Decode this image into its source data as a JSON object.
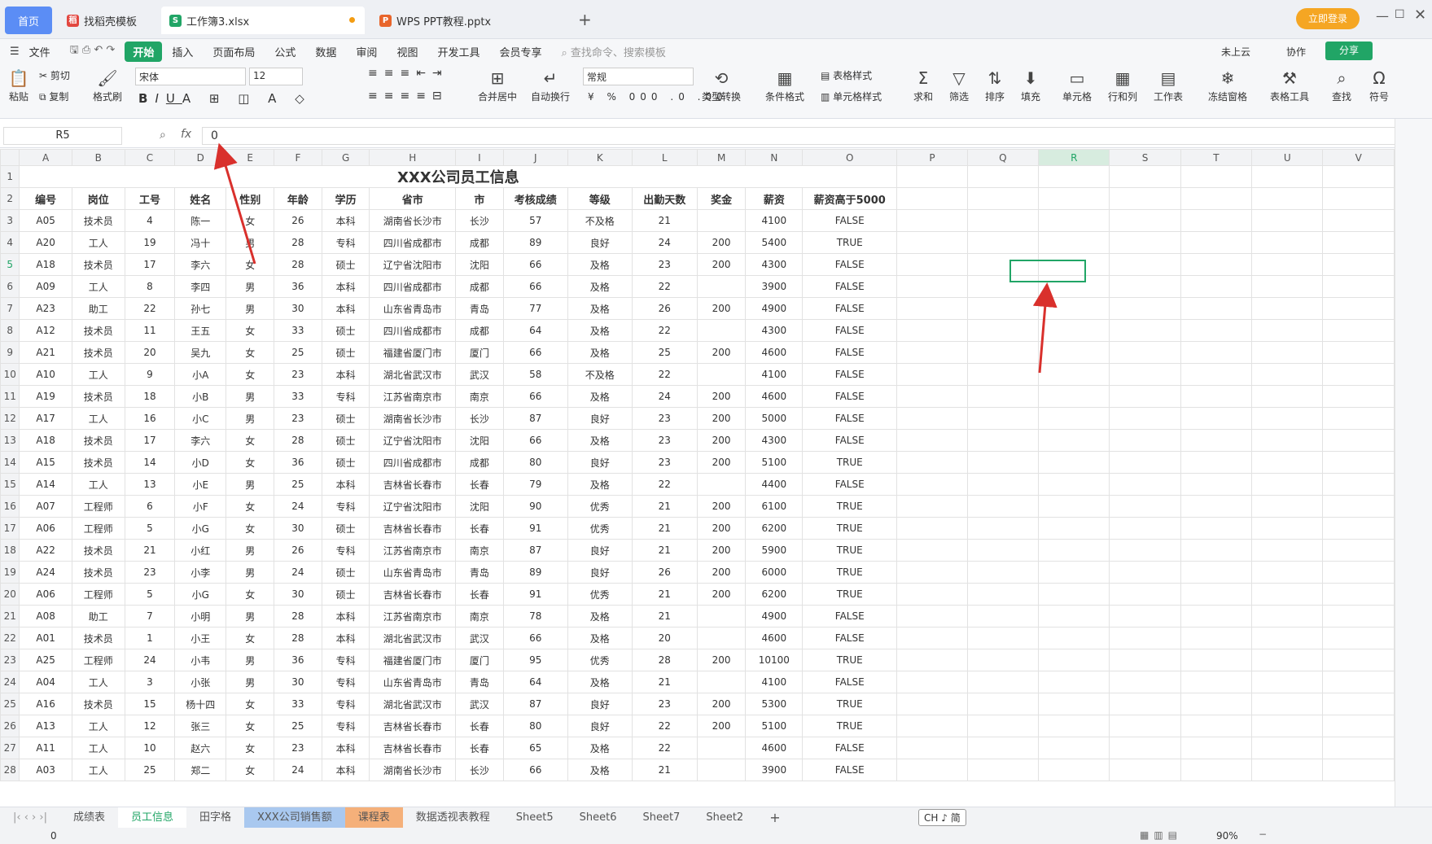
{
  "tabs": {
    "home": "首页",
    "t1": "找稻壳模板",
    "t2": "工作簿3.xlsx",
    "t3": "WPS PPT教程.pptx"
  },
  "titlebar": {
    "login": "立即登录"
  },
  "menu": [
    "文件",
    "开始",
    "插入",
    "页面布局",
    "公式",
    "数据",
    "审阅",
    "视图",
    "开发工具",
    "会员专享"
  ],
  "search": "查找命令、搜索模板",
  "right_menu": {
    "cloud": "未上云",
    "collab": "协作",
    "share": "分享"
  },
  "ribbon": {
    "paste": "粘贴",
    "cut": "剪切",
    "copy": "复制",
    "format_painter": "格式刷",
    "font": "宋体",
    "size": "12",
    "merge": "合并居中",
    "wrap": "自动换行",
    "numfmt": "常规",
    "convert": "类型转换",
    "cond": "条件格式",
    "table_style": "表格样式",
    "cell_style": "单元格样式",
    "sum": "求和",
    "filter": "筛选",
    "sort": "排序",
    "fill": "填充",
    "cell": "单元格",
    "rowcol": "行和列",
    "sheet": "工作表",
    "freeze": "冻结窗格",
    "tools": "表格工具",
    "find": "查找",
    "symbol": "符号"
  },
  "formula": {
    "cellref": "R5",
    "fx": "fx",
    "value": "0"
  },
  "sheet_title": "XXX公司员工信息",
  "columns": [
    "A",
    "B",
    "C",
    "D",
    "E",
    "F",
    "G",
    "H",
    "I",
    "J",
    "K",
    "L",
    "M",
    "N",
    "O",
    "P",
    "Q",
    "R",
    "S",
    "T",
    "U",
    "V"
  ],
  "headers": [
    "编号",
    "岗位",
    "工号",
    "姓名",
    "性别",
    "年龄",
    "学历",
    "省市",
    "市",
    "考核成绩",
    "等级",
    "出勤天数",
    "奖金",
    "薪资",
    "薪资高于5000"
  ],
  "rows": [
    [
      "A05",
      "技术员",
      "4",
      "陈一",
      "女",
      "26",
      "本科",
      "湖南省长沙市",
      "长沙",
      "57",
      "不及格",
      "21",
      "",
      "4100",
      "FALSE"
    ],
    [
      "A20",
      "工人",
      "19",
      "冯十",
      "男",
      "28",
      "专科",
      "四川省成都市",
      "成都",
      "89",
      "良好",
      "24",
      "200",
      "5400",
      "TRUE"
    ],
    [
      "A18",
      "技术员",
      "17",
      "李六",
      "女",
      "28",
      "硕士",
      "辽宁省沈阳市",
      "沈阳",
      "66",
      "及格",
      "23",
      "200",
      "4300",
      "FALSE"
    ],
    [
      "A09",
      "工人",
      "8",
      "李四",
      "男",
      "36",
      "本科",
      "四川省成都市",
      "成都",
      "66",
      "及格",
      "22",
      "",
      "3900",
      "FALSE"
    ],
    [
      "A23",
      "助工",
      "22",
      "孙七",
      "男",
      "30",
      "本科",
      "山东省青岛市",
      "青岛",
      "77",
      "及格",
      "26",
      "200",
      "4900",
      "FALSE"
    ],
    [
      "A12",
      "技术员",
      "11",
      "王五",
      "女",
      "33",
      "硕士",
      "四川省成都市",
      "成都",
      "64",
      "及格",
      "22",
      "",
      "4300",
      "FALSE"
    ],
    [
      "A21",
      "技术员",
      "20",
      "吴九",
      "女",
      "25",
      "硕士",
      "福建省厦门市",
      "厦门",
      "66",
      "及格",
      "25",
      "200",
      "4600",
      "FALSE"
    ],
    [
      "A10",
      "工人",
      "9",
      "小A",
      "女",
      "23",
      "本科",
      "湖北省武汉市",
      "武汉",
      "58",
      "不及格",
      "22",
      "",
      "4100",
      "FALSE"
    ],
    [
      "A19",
      "技术员",
      "18",
      "小B",
      "男",
      "33",
      "专科",
      "江苏省南京市",
      "南京",
      "66",
      "及格",
      "24",
      "200",
      "4600",
      "FALSE"
    ],
    [
      "A17",
      "工人",
      "16",
      "小C",
      "男",
      "23",
      "硕士",
      "湖南省长沙市",
      "长沙",
      "87",
      "良好",
      "23",
      "200",
      "5000",
      "FALSE"
    ],
    [
      "A18",
      "技术员",
      "17",
      "李六",
      "女",
      "28",
      "硕士",
      "辽宁省沈阳市",
      "沈阳",
      "66",
      "及格",
      "23",
      "200",
      "4300",
      "FALSE"
    ],
    [
      "A15",
      "技术员",
      "14",
      "小D",
      "女",
      "36",
      "硕士",
      "四川省成都市",
      "成都",
      "80",
      "良好",
      "23",
      "200",
      "5100",
      "TRUE"
    ],
    [
      "A14",
      "工人",
      "13",
      "小E",
      "男",
      "25",
      "本科",
      "吉林省长春市",
      "长春",
      "79",
      "及格",
      "22",
      "",
      "4400",
      "FALSE"
    ],
    [
      "A07",
      "工程师",
      "6",
      "小F",
      "女",
      "24",
      "专科",
      "辽宁省沈阳市",
      "沈阳",
      "90",
      "优秀",
      "21",
      "200",
      "6100",
      "TRUE"
    ],
    [
      "A06",
      "工程师",
      "5",
      "小G",
      "女",
      "30",
      "硕士",
      "吉林省长春市",
      "长春",
      "91",
      "优秀",
      "21",
      "200",
      "6200",
      "TRUE"
    ],
    [
      "A22",
      "技术员",
      "21",
      "小红",
      "男",
      "26",
      "专科",
      "江苏省南京市",
      "南京",
      "87",
      "良好",
      "21",
      "200",
      "5900",
      "TRUE"
    ],
    [
      "A24",
      "技术员",
      "23",
      "小李",
      "男",
      "24",
      "硕士",
      "山东省青岛市",
      "青岛",
      "89",
      "良好",
      "26",
      "200",
      "6000",
      "TRUE"
    ],
    [
      "A06",
      "工程师",
      "5",
      "小G",
      "女",
      "30",
      "硕士",
      "吉林省长春市",
      "长春",
      "91",
      "优秀",
      "21",
      "200",
      "6200",
      "TRUE"
    ],
    [
      "A08",
      "助工",
      "7",
      "小明",
      "男",
      "28",
      "本科",
      "江苏省南京市",
      "南京",
      "78",
      "及格",
      "21",
      "",
      "4900",
      "FALSE"
    ],
    [
      "A01",
      "技术员",
      "1",
      "小王",
      "女",
      "28",
      "本科",
      "湖北省武汉市",
      "武汉",
      "66",
      "及格",
      "20",
      "",
      "4600",
      "FALSE"
    ],
    [
      "A25",
      "工程师",
      "24",
      "小韦",
      "男",
      "36",
      "专科",
      "福建省厦门市",
      "厦门",
      "95",
      "优秀",
      "28",
      "200",
      "10100",
      "TRUE"
    ],
    [
      "A04",
      "工人",
      "3",
      "小张",
      "男",
      "30",
      "专科",
      "山东省青岛市",
      "青岛",
      "64",
      "及格",
      "21",
      "",
      "4100",
      "FALSE"
    ],
    [
      "A16",
      "技术员",
      "15",
      "杨十四",
      "女",
      "33",
      "专科",
      "湖北省武汉市",
      "武汉",
      "87",
      "良好",
      "23",
      "200",
      "5300",
      "TRUE"
    ],
    [
      "A13",
      "工人",
      "12",
      "张三",
      "女",
      "25",
      "专科",
      "吉林省长春市",
      "长春",
      "80",
      "良好",
      "22",
      "200",
      "5100",
      "TRUE"
    ],
    [
      "A11",
      "工人",
      "10",
      "赵六",
      "女",
      "23",
      "本科",
      "吉林省长春市",
      "长春",
      "65",
      "及格",
      "22",
      "",
      "4600",
      "FALSE"
    ],
    [
      "A03",
      "工人",
      "25",
      "郑二",
      "女",
      "24",
      "本科",
      "湖南省长沙市",
      "长沙",
      "66",
      "及格",
      "21",
      "",
      "3900",
      "FALSE"
    ]
  ],
  "sheets": [
    "成绩表",
    "员工信息",
    "田字格",
    "XXX公司销售额",
    "课程表",
    "数据透视表教程",
    "Sheet5",
    "Sheet6",
    "Sheet7",
    "Sheet2"
  ],
  "status": {
    "value": "0",
    "zoom": "90%",
    "ime": "CH ♪ 简"
  },
  "colors": {
    "accent": "#21a566",
    "home": "#5b8df5",
    "arrow": "#d9302c"
  }
}
